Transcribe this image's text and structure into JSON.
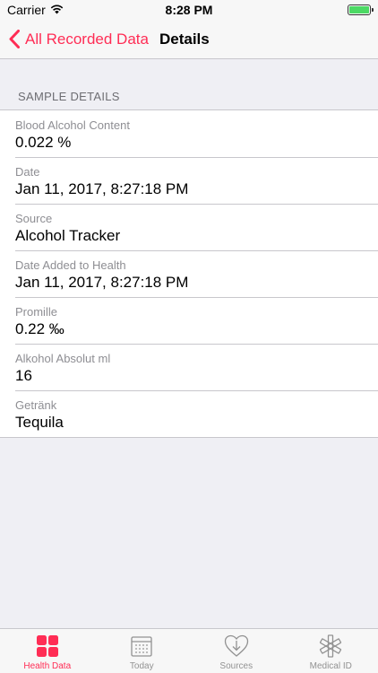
{
  "status_bar": {
    "carrier": "Carrier",
    "time": "8:28 PM"
  },
  "nav": {
    "back_label": "All Recorded Data",
    "title": "Details"
  },
  "section": {
    "header": "SAMPLE DETAILS"
  },
  "rows": [
    {
      "label": "Blood Alcohol Content",
      "value": "0.022 %"
    },
    {
      "label": "Date",
      "value": "Jan 11, 2017, 8:27:18 PM"
    },
    {
      "label": "Source",
      "value": "Alcohol Tracker"
    },
    {
      "label": "Date Added to Health",
      "value": "Jan 11, 2017, 8:27:18 PM"
    },
    {
      "label": "Promille",
      "value": "0.22 ‰"
    },
    {
      "label": "Alkohol Absolut ml",
      "value": "16"
    },
    {
      "label": "Getränk",
      "value": "Tequila"
    }
  ],
  "tabs": [
    {
      "label": "Health Data",
      "icon": "grid-icon",
      "active": true
    },
    {
      "label": "Today",
      "icon": "calendar-icon",
      "active": false
    },
    {
      "label": "Sources",
      "icon": "heart-download-icon",
      "active": false
    },
    {
      "label": "Medical ID",
      "icon": "star-of-life-icon",
      "active": false
    }
  ],
  "colors": {
    "accent": "#ff2d55",
    "battery": "#4cd964",
    "inactive_tab": "#929292"
  }
}
